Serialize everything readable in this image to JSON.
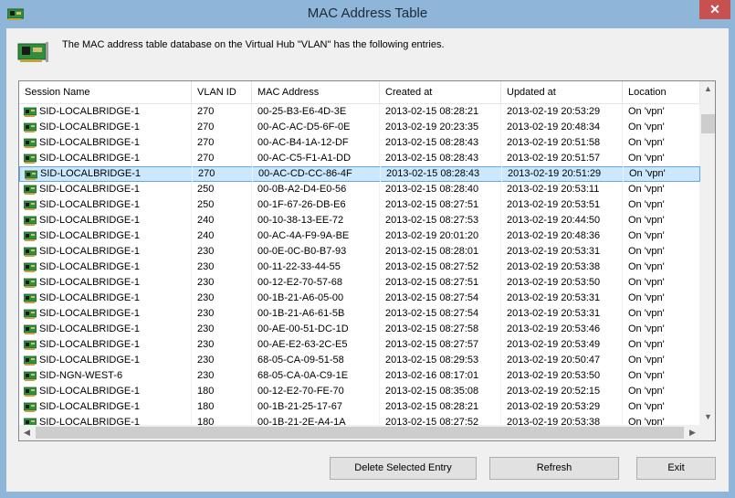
{
  "window": {
    "title": "MAC Address Table",
    "close_glyph": "✕"
  },
  "description": "The MAC address table database on the Virtual Hub \"VLAN\" has the following entries.",
  "columns": [
    "Session Name",
    "VLAN ID",
    "MAC Address",
    "Created at",
    "Updated at",
    "Location"
  ],
  "rows": [
    [
      "SID-LOCALBRIDGE-1",
      "270",
      "00-25-B3-E6-4D-3E",
      "2013-02-15 08:28:21",
      "2013-02-19 20:53:29",
      "On 'vpn'"
    ],
    [
      "SID-LOCALBRIDGE-1",
      "270",
      "00-AC-AC-D5-6F-0E",
      "2013-02-19 20:23:35",
      "2013-02-19 20:48:34",
      "On 'vpn'"
    ],
    [
      "SID-LOCALBRIDGE-1",
      "270",
      "00-AC-B4-1A-12-DF",
      "2013-02-15 08:28:43",
      "2013-02-19 20:51:58",
      "On 'vpn'"
    ],
    [
      "SID-LOCALBRIDGE-1",
      "270",
      "00-AC-C5-F1-A1-DD",
      "2013-02-15 08:28:43",
      "2013-02-19 20:51:57",
      "On 'vpn'"
    ],
    [
      "SID-LOCALBRIDGE-1",
      "270",
      "00-AC-CD-CC-86-4F",
      "2013-02-15 08:28:43",
      "2013-02-19 20:51:29",
      "On 'vpn'"
    ],
    [
      "SID-LOCALBRIDGE-1",
      "250",
      "00-0B-A2-D4-E0-56",
      "2013-02-15 08:28:40",
      "2013-02-19 20:53:11",
      "On 'vpn'"
    ],
    [
      "SID-LOCALBRIDGE-1",
      "250",
      "00-1F-67-26-DB-E6",
      "2013-02-15 08:27:51",
      "2013-02-19 20:53:51",
      "On 'vpn'"
    ],
    [
      "SID-LOCALBRIDGE-1",
      "240",
      "00-10-38-13-EE-72",
      "2013-02-15 08:27:53",
      "2013-02-19 20:44:50",
      "On 'vpn'"
    ],
    [
      "SID-LOCALBRIDGE-1",
      "240",
      "00-AC-4A-F9-9A-BE",
      "2013-02-19 20:01:20",
      "2013-02-19 20:48:36",
      "On 'vpn'"
    ],
    [
      "SID-LOCALBRIDGE-1",
      "230",
      "00-0E-0C-B0-B7-93",
      "2013-02-15 08:28:01",
      "2013-02-19 20:53:31",
      "On 'vpn'"
    ],
    [
      "SID-LOCALBRIDGE-1",
      "230",
      "00-11-22-33-44-55",
      "2013-02-15 08:27:52",
      "2013-02-19 20:53:38",
      "On 'vpn'"
    ],
    [
      "SID-LOCALBRIDGE-1",
      "230",
      "00-12-E2-70-57-68",
      "2013-02-15 08:27:51",
      "2013-02-19 20:53:50",
      "On 'vpn'"
    ],
    [
      "SID-LOCALBRIDGE-1",
      "230",
      "00-1B-21-A6-05-00",
      "2013-02-15 08:27:54",
      "2013-02-19 20:53:31",
      "On 'vpn'"
    ],
    [
      "SID-LOCALBRIDGE-1",
      "230",
      "00-1B-21-A6-61-5B",
      "2013-02-15 08:27:54",
      "2013-02-19 20:53:31",
      "On 'vpn'"
    ],
    [
      "SID-LOCALBRIDGE-1",
      "230",
      "00-AE-00-51-DC-1D",
      "2013-02-15 08:27:58",
      "2013-02-19 20:53:46",
      "On 'vpn'"
    ],
    [
      "SID-LOCALBRIDGE-1",
      "230",
      "00-AE-E2-63-2C-E5",
      "2013-02-15 08:27:57",
      "2013-02-19 20:53:49",
      "On 'vpn'"
    ],
    [
      "SID-LOCALBRIDGE-1",
      "230",
      "68-05-CA-09-51-58",
      "2013-02-15 08:29:53",
      "2013-02-19 20:50:47",
      "On 'vpn'"
    ],
    [
      "SID-NGN-WEST-6",
      "230",
      "68-05-CA-0A-C9-1E",
      "2013-02-16 08:17:01",
      "2013-02-19 20:53:50",
      "On 'vpn'"
    ],
    [
      "SID-LOCALBRIDGE-1",
      "180",
      "00-12-E2-70-FE-70",
      "2013-02-15 08:35:08",
      "2013-02-19 20:52:15",
      "On 'vpn'"
    ],
    [
      "SID-LOCALBRIDGE-1",
      "180",
      "00-1B-21-25-17-67",
      "2013-02-15 08:28:21",
      "2013-02-19 20:53:29",
      "On 'vpn'"
    ],
    [
      "SID-LOCALBRIDGE-1",
      "180",
      "00-1B-21-2E-A4-1A",
      "2013-02-15 08:27:52",
      "2013-02-19 20:53:38",
      "On 'vpn'"
    ]
  ],
  "selected_row": 4,
  "scroll": {
    "up": "▲",
    "down": "▼",
    "left": "◀",
    "right": "▶"
  },
  "buttons": {
    "delete": "Delete Selected Entry",
    "refresh": "Refresh",
    "exit": "Exit"
  },
  "colors": {
    "titlebar": "#8fb6d9",
    "close": "#c75050",
    "selection": "#cce8ff",
    "selection_border": "#66a7e8"
  }
}
